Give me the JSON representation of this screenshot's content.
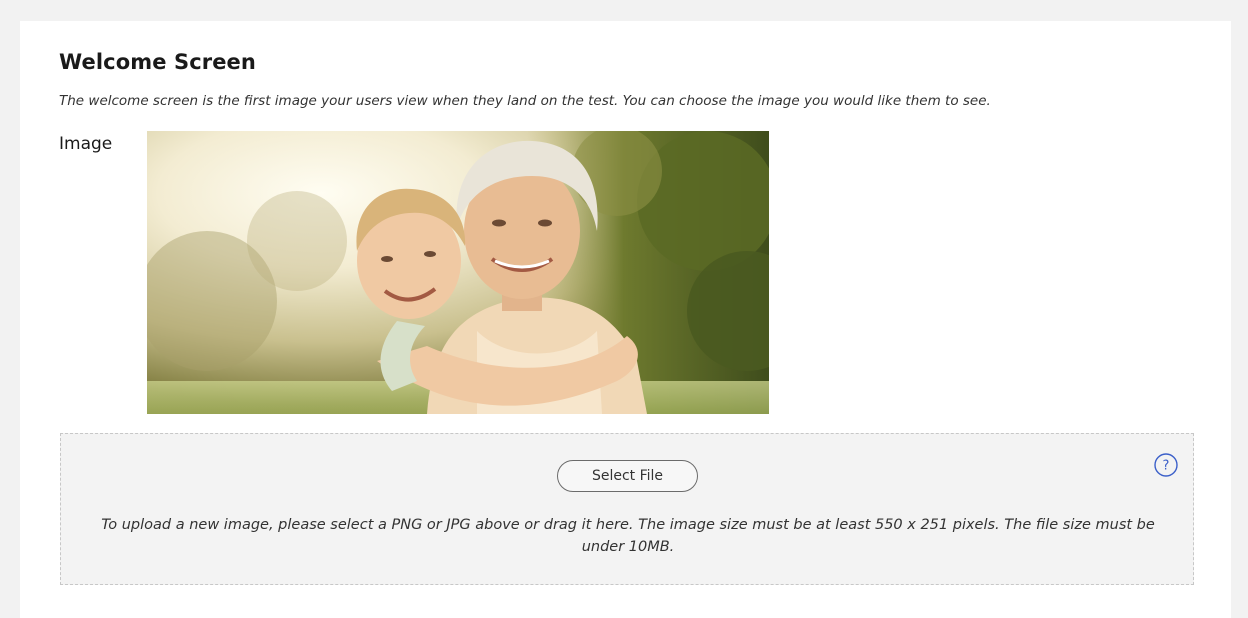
{
  "welcome": {
    "title": "Welcome Screen",
    "description": "The welcome screen is the first image your users view when they land on the test. You can choose the image you would like them to see."
  },
  "image_section": {
    "label": "Image",
    "photo_icon": "welcome-photo"
  },
  "upload": {
    "button_label": "Select File",
    "help_icon": "question-circle-icon",
    "help_glyph": "?",
    "instructions": "To upload a new image, please select a PNG or JPG above or drag it here. The image size must be at least 550 x 251 pixels. The file size must be under 10MB."
  },
  "colors": {
    "accent": "#3b5fc9",
    "dropzone_bg": "#f3f3f3"
  }
}
